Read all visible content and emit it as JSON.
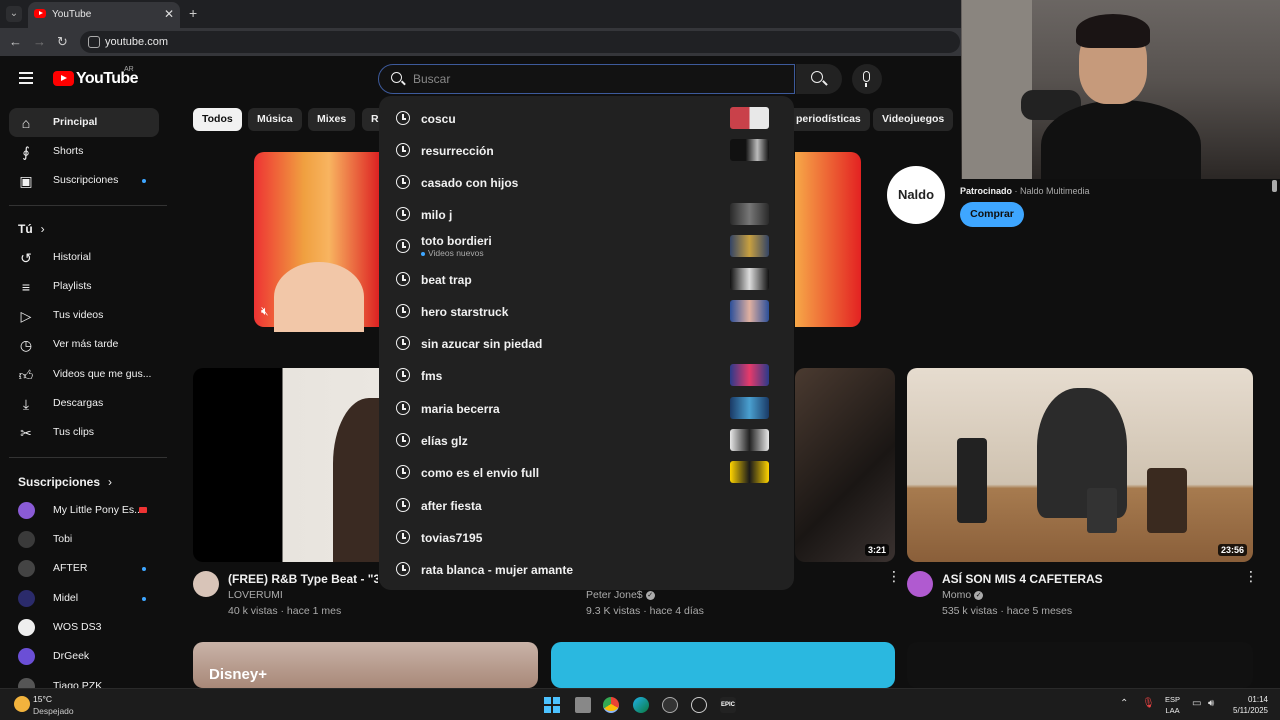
{
  "browser": {
    "tab_title": "YouTube",
    "url": "youtube.com"
  },
  "header": {
    "logo_text": "YouTube",
    "country_code": "AR",
    "search_placeholder": "Buscar",
    "search_value": ""
  },
  "sidebar": {
    "main": [
      {
        "label": "Principal",
        "icon": "home-icon",
        "active": true
      },
      {
        "label": "Shorts",
        "icon": "shorts-icon"
      },
      {
        "label": "Suscripciones",
        "icon": "subscriptions-icon",
        "dot": true
      }
    ],
    "you_header": "Tú",
    "you": [
      {
        "label": "Historial",
        "icon": "history-icon"
      },
      {
        "label": "Playlists",
        "icon": "playlist-icon"
      },
      {
        "label": "Tus videos",
        "icon": "your-videos-icon"
      },
      {
        "label": "Ver más tarde",
        "icon": "watch-later-icon"
      },
      {
        "label": "Videos que me gus...",
        "icon": "like-icon"
      },
      {
        "label": "Descargas",
        "icon": "download-icon"
      },
      {
        "label": "Tus clips",
        "icon": "clips-icon"
      }
    ],
    "subs_header": "Suscripciones",
    "subs": [
      {
        "label": "My Little Pony Es...",
        "color": "#8a5bd6",
        "live": true
      },
      {
        "label": "Tobi",
        "color": "#3a3a3a"
      },
      {
        "label": "AFTER",
        "color": "#444444",
        "dot": true
      },
      {
        "label": "Midel",
        "color": "#2b2b6b",
        "dot": true
      },
      {
        "label": "WOS DS3",
        "color": "#eeeeee"
      },
      {
        "label": "DrGeek",
        "color": "#6b4fd6"
      },
      {
        "label": "Tiago PZK",
        "color": "#555555"
      }
    ]
  },
  "chips": [
    "Todos",
    "Música",
    "Mixes",
    "R",
    "periodísticas",
    "Videojuegos"
  ],
  "ad": {
    "logo_text": "Naldo",
    "sponsored": "Patrocinado",
    "advertiser": "Naldo Multimedia",
    "cta": "Comprar"
  },
  "suggestions": [
    {
      "text": "coscu",
      "thumb": [
        "#c9414a",
        "#e8e8e8"
      ]
    },
    {
      "text": "resurrección",
      "thumb": [
        "#111111",
        "#bbbbbb"
      ]
    },
    {
      "text": "casado con hijos"
    },
    {
      "text": "milo j",
      "thumb": [
        "#2a2a2a",
        "#777777"
      ]
    },
    {
      "text": "toto bordieri",
      "sub": "Videos nuevos",
      "thumb": [
        "#334466",
        "#c8a040"
      ]
    },
    {
      "text": "beat trap",
      "thumb": [
        "#111111",
        "#dddddd"
      ]
    },
    {
      "text": "hero starstruck",
      "thumb": [
        "#2b4f9a",
        "#e0b0a0"
      ]
    },
    {
      "text": "sin azucar sin piedad"
    },
    {
      "text": "fms",
      "thumb": [
        "#2a3a8a",
        "#e63a6a"
      ]
    },
    {
      "text": "maria becerra",
      "thumb": [
        "#1a3a66",
        "#4aa0d0"
      ]
    },
    {
      "text": "elías glz",
      "thumb": [
        "#e8e8e8",
        "#222222"
      ]
    },
    {
      "text": "como es el envio full",
      "thumb": [
        "#ffd400",
        "#1a1a1a"
      ]
    },
    {
      "text": "after fiesta"
    },
    {
      "text": "tovias7195"
    },
    {
      "text": "rata blanca - mujer amante"
    }
  ],
  "videos": [
    {
      "title": "(FREE) R&B Type Beat - \"3AM",
      "channel": "LOVERUMI",
      "meta": "40 k vistas · hace 1 mes"
    },
    {
      "title": "",
      "channel": "Peter Jone$",
      "verified": true,
      "meta": "9.3 K vistas · hace 4 días",
      "duration": "3:21"
    },
    {
      "title": "ASÍ SON MIS 4 CAFETERAS",
      "channel": "Momo",
      "verified": true,
      "meta": "535 k vistas · hace 5 meses",
      "duration": "23:56"
    }
  ],
  "taskbar": {
    "temp": "15°C",
    "weather": "Despejado",
    "lang_1": "ESP",
    "lang_2": "LAA",
    "time": "01:14",
    "date": "5/11/2025"
  }
}
